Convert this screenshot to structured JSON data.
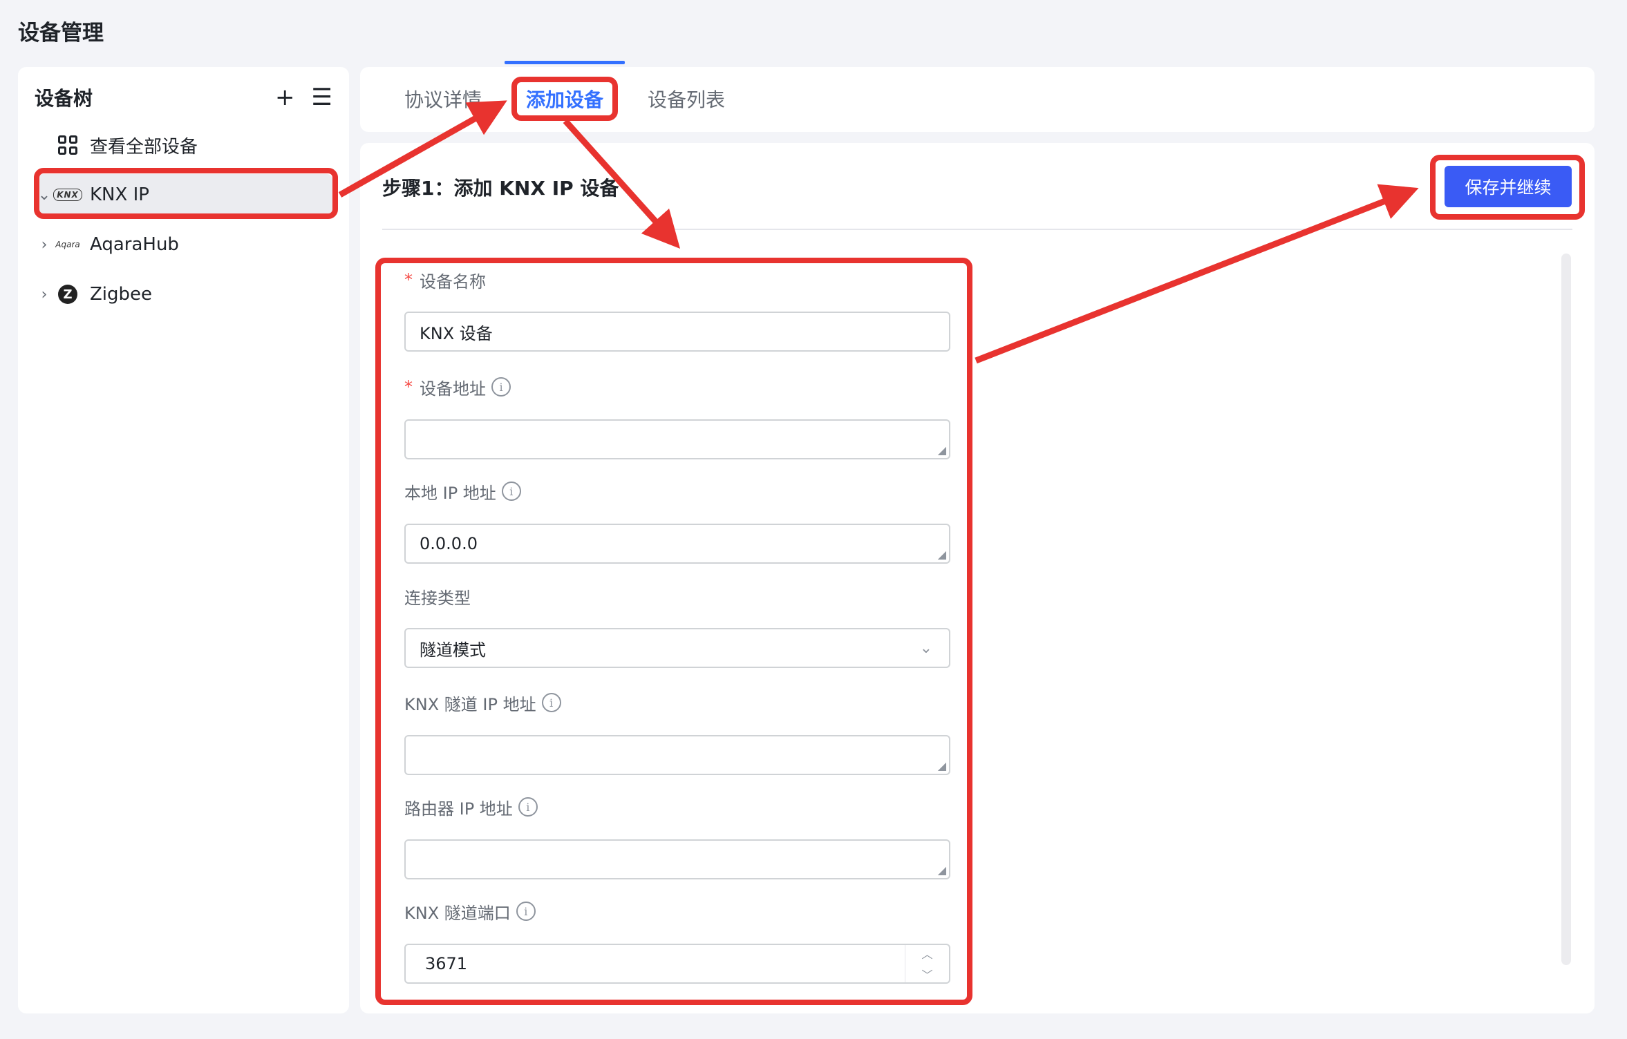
{
  "page": {
    "title": "设备管理"
  },
  "sidebar": {
    "title": "设备树",
    "add_icon": "+",
    "list_icon": "☰",
    "items": [
      {
        "label": "查看全部设备",
        "icon": "grid-icon"
      },
      {
        "label": "KNX IP",
        "icon": "knx-logo-icon",
        "logo_text": "KNX",
        "expanded": true,
        "selected": true
      },
      {
        "label": "AqaraHub",
        "icon": "aqara-logo-icon",
        "logo_text": "Aqara"
      },
      {
        "label": "Zigbee",
        "icon": "zigbee-logo-icon",
        "logo_text": "Z"
      }
    ]
  },
  "tabs": [
    {
      "label": "协议详情"
    },
    {
      "label": "添加设备",
      "active": true
    },
    {
      "label": "设备列表"
    }
  ],
  "main": {
    "step_title": "步骤1：添加 KNX IP 设备",
    "save_label": "保存并继续",
    "form": {
      "device_name": {
        "label": "设备名称",
        "value": "KNX 设备",
        "required": true
      },
      "device_address": {
        "label": "设备地址",
        "value": "",
        "required": true
      },
      "local_ip": {
        "label": "本地 IP 地址",
        "value": "0.0.0.0"
      },
      "connection_type": {
        "label": "连接类型",
        "value": "隧道模式"
      },
      "tunnel_ip": {
        "label": "KNX 隧道 IP 地址",
        "value": ""
      },
      "router_ip": {
        "label": "路由器 IP 地址",
        "value": ""
      },
      "tunnel_port": {
        "label": "KNX 隧道端口",
        "value": "3671"
      }
    }
  },
  "colors": {
    "accent": "#3370ff",
    "primary_button": "#3a5bf5",
    "annotation_red": "#e8332f",
    "required": "#f54a45"
  }
}
